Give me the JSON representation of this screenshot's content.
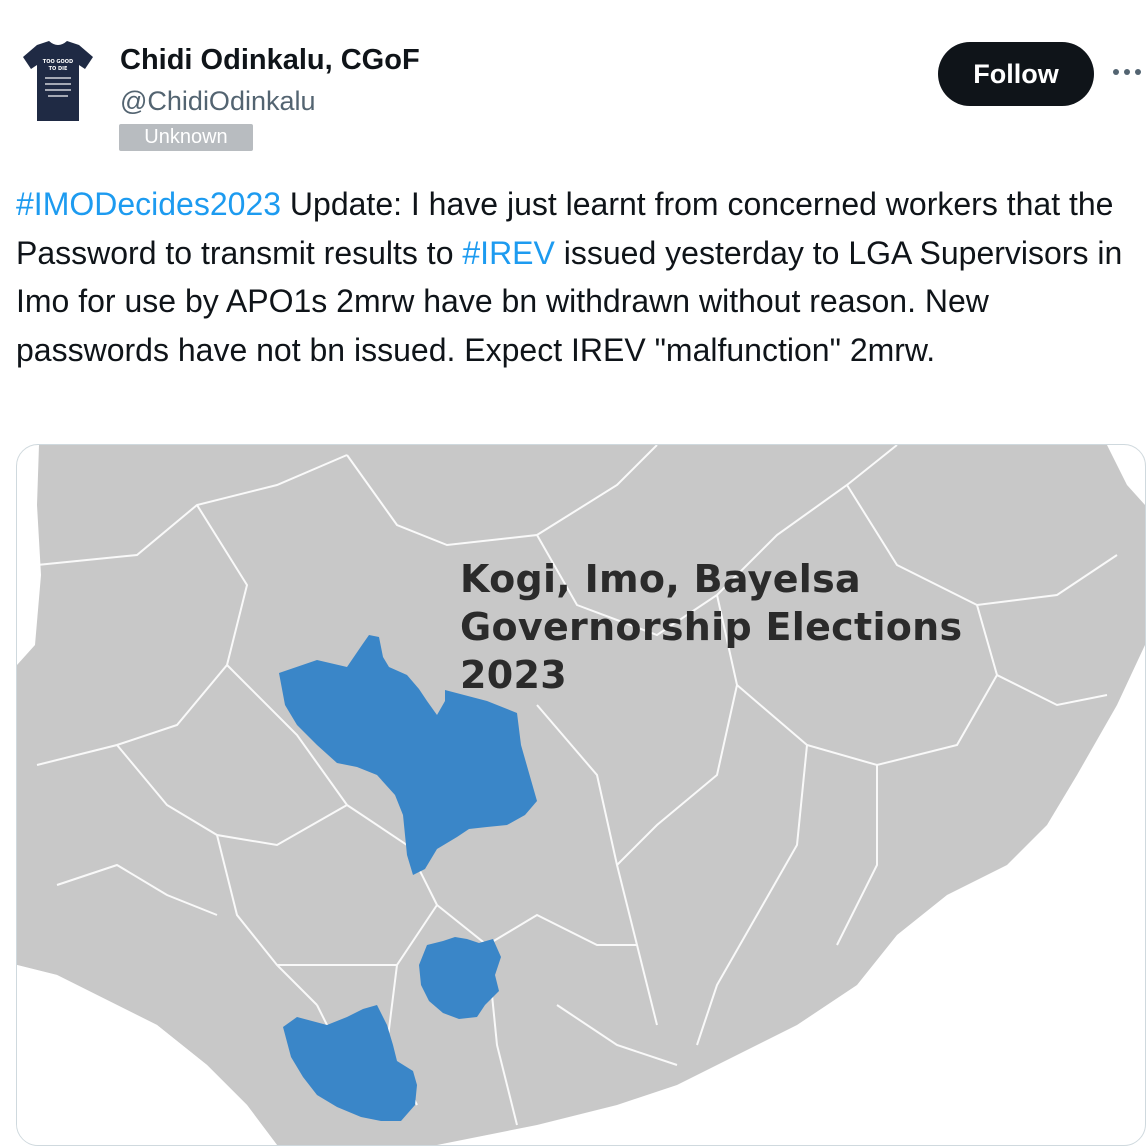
{
  "author": {
    "name": "Chidi Odinkalu, CGoF",
    "handle": "@ChidiOdinkalu",
    "label_badge": "Unknown",
    "avatar_icon": "tshirt-avatar-icon",
    "avatar_shirt_text": "TOO GOOD TO DIE"
  },
  "actions": {
    "follow_label": "Follow",
    "more_icon": "more-horizontal-icon"
  },
  "tweet": {
    "hashtag1": "#IMODecides2023",
    "text1": " Update: I have just learnt from concerned workers that the Password to transmit results to ",
    "hashtag2": "#IREV",
    "text2": " issued yesterday to LGA Supervisors in Imo for use by APO1s 2mrw have bn withdrawn without reason. New passwords have not bn issued. Expect IREV \"malfunction\" 2mrw."
  },
  "media": {
    "title_line1": "Kogi, Imo, Bayelsa",
    "title_line2": "Governorship Elections",
    "title_line3": "2023",
    "land_color": "#c8c8c8",
    "border_color": "#ffffff",
    "highlight_color": "#3a86c8",
    "sea_color": "#ffffff"
  },
  "colors": {
    "link": "#1d9bf0",
    "follow_bg": "#0f1419",
    "badge_bg": "#b8bcc0"
  }
}
